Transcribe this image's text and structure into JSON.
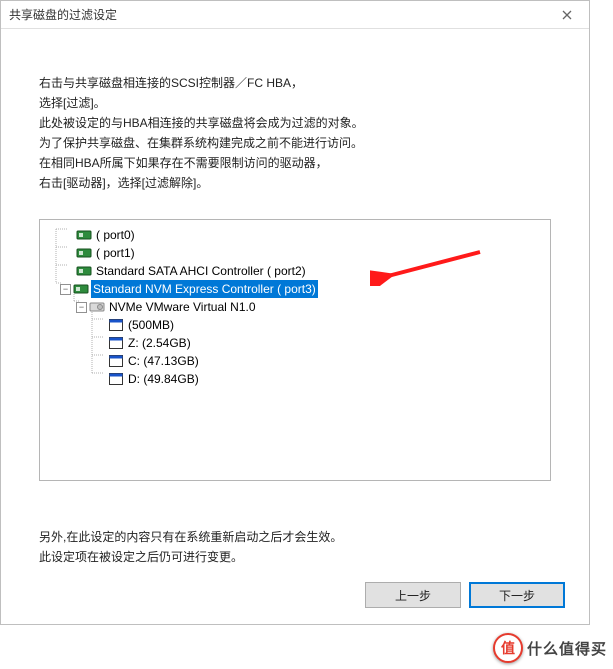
{
  "window": {
    "title": "共享磁盘的过滤设定"
  },
  "instructions": {
    "l1": "右击与共享磁盘相连接的SCSI控制器／FC HBA，",
    "l2": "选择[过滤]。",
    "l3": "此处被设定的与HBA相连接的共享磁盘将会成为过滤的对象。",
    "l4": "为了保护共享磁盘、在集群系统构建完成之前不能进行访问。",
    "l5": "在相同HBA所属下如果存在不需要限制访问的驱动器，",
    "l6": "右击[驱动器]，选择[过滤解除]。"
  },
  "tree": {
    "n0": "( port0)",
    "n1": "( port1)",
    "n2": "Standard SATA AHCI Controller ( port2)",
    "n3": "Standard NVM Express Controller ( port3)",
    "n3c": "NVMe     VMware Virtual N1.0",
    "d0": "(500MB)",
    "d1": "Z:  (2.54GB)",
    "d2": "C:  (47.13GB)",
    "d3": "D:  (49.84GB)"
  },
  "footnote": {
    "l1": "另外,在此设定的内容只有在系统重新启动之后才会生效。",
    "l2": "此设定项在被设定之后仍可进行变更。"
  },
  "buttons": {
    "back": "上一步",
    "next": "下一步"
  },
  "watermark": {
    "badge": "值",
    "text": "什么值得买"
  }
}
